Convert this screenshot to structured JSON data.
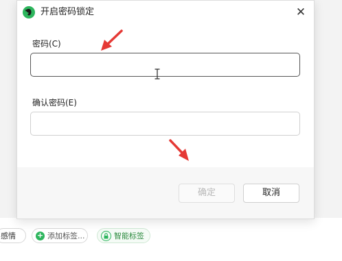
{
  "dialog": {
    "title": "开启密码锁定",
    "close_glyph": "✕",
    "password_label": "密码(C)",
    "password_value": "",
    "confirm_label": "确认密码(E)",
    "confirm_value": "",
    "ok_label": "确定",
    "cancel_label": "取消"
  },
  "tags": {
    "partial_label": "感情",
    "add_label": "添加标签...",
    "add_glyph": "+",
    "smart_label": "智能标签"
  },
  "colors": {
    "accent_green": "#2db55d",
    "annotation_arrow": "#e53935"
  },
  "icons": {
    "app_logo": "evernote-elephant-icon",
    "close": "close-icon",
    "add_tag": "plus-circle-icon",
    "smart_tag": "lock-tag-icon"
  }
}
